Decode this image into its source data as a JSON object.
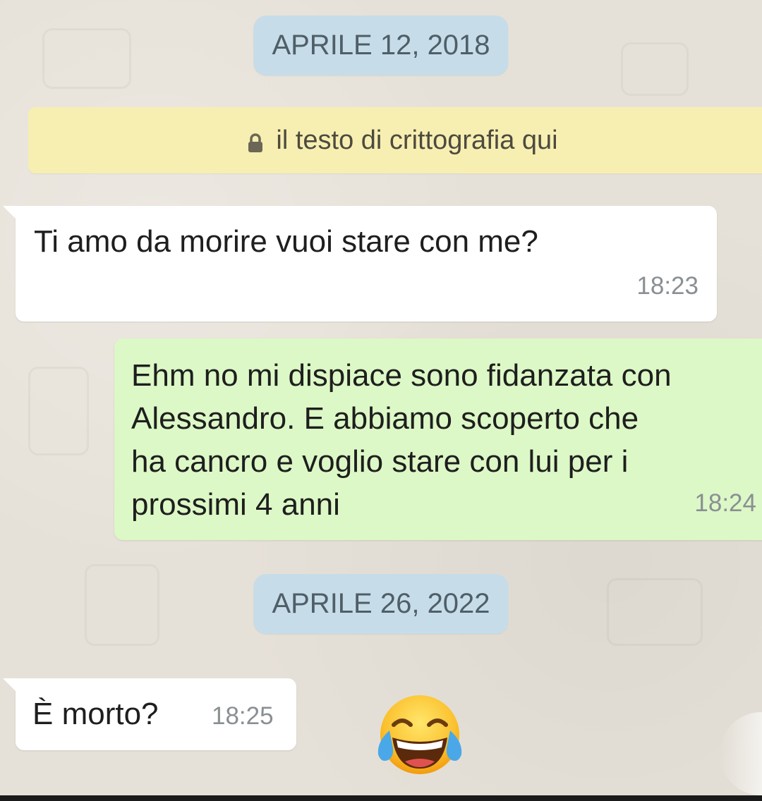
{
  "chat": {
    "date_1": "APRILE 12, 2018",
    "encryption_notice": "il testo di crittografia qui",
    "encryption_icon": "lock-icon",
    "date_2": "APRILE 26, 2022",
    "messages": [
      {
        "direction": "incoming",
        "text": "Ti amo da morire vuoi stare con me?",
        "time": "18:23"
      },
      {
        "direction": "outgoing",
        "text": "Ehm no mi dispiace sono fidanzata con\nAlessandro. E abbiamo scoperto che\nha cancro e voglio stare con lui per i\nprossimi 4 anni",
        "time": "18:24"
      },
      {
        "direction": "incoming",
        "text": "È morto?",
        "time": "18:25"
      }
    ],
    "reaction_emoji": "face-with-tears-of-joy-icon"
  },
  "colors": {
    "background": "#e6e1d8",
    "date_chip": "#c6dde9",
    "encryption_notice": "#f7efb2",
    "incoming_bubble": "#ffffff",
    "outgoing_bubble": "#dcf8c6",
    "timestamp": "#8a8f93"
  }
}
